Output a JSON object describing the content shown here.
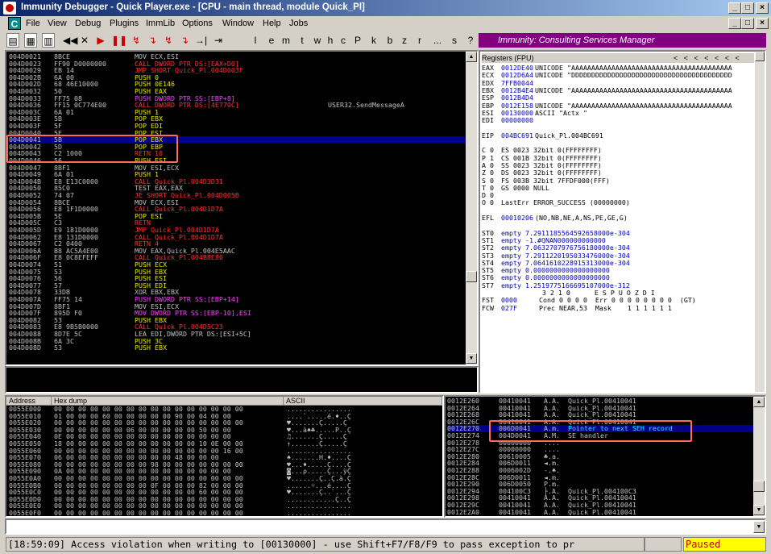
{
  "window": {
    "title": "Immunity Debugger - Quick Player.exe - [CPU - main thread, module Quick_Pl]"
  },
  "menu": [
    "File",
    "View",
    "Debug",
    "Plugins",
    "ImmLib",
    "Options",
    "Window",
    "Help",
    "Jobs"
  ],
  "toolbar": {
    "letters": [
      "l",
      "e",
      "m",
      "t",
      "w",
      "h",
      "c",
      "P",
      "k",
      "b",
      "z",
      "r",
      "...",
      "s",
      "?"
    ],
    "banner": "Immunity: Consulting Services Manager"
  },
  "disasm": {
    "rows": [
      {
        "a": "004D0021",
        "h": "8BCE",
        "i": "MOV ECX,ESI",
        "c": "",
        "k": "w"
      },
      {
        "a": "004D0023",
        "h": "FF90 D0000000",
        "i": "CALL DWORD PTR DS:[EAX+D0]",
        "c": "",
        "k": "r"
      },
      {
        "a": "004D0029",
        "h": "EB 14",
        "i": "JMP SHORT Quick_Pl.004D003F",
        "c": "",
        "k": "r"
      },
      {
        "a": "004D002B",
        "h": "6A 00",
        "i": "PUSH 0",
        "c": "",
        "k": "y"
      },
      {
        "a": "004D002D",
        "h": "68 46E10000",
        "i": "PUSH 0E146",
        "c": "",
        "k": "y"
      },
      {
        "a": "004D0032",
        "h": "50",
        "i": "PUSH EAX",
        "c": "",
        "k": "y"
      },
      {
        "a": "004D0033",
        "h": "FF75 08",
        "i": "PUSH DWORD PTR SS:[EBP+8]",
        "c": "",
        "k": "m"
      },
      {
        "a": "004D0036",
        "h": "FF15 0C774E00",
        "i": "CALL DWORD PTR DS:[4E770C]",
        "c": "USER32.SendMessageA",
        "k": "r"
      },
      {
        "a": "004D003C",
        "h": "6A 01",
        "i": "PUSH 1",
        "c": "",
        "k": "y"
      },
      {
        "a": "004D003E",
        "h": "5B",
        "i": "POP EBX",
        "c": "",
        "k": "y"
      },
      {
        "a": "004D003F",
        "h": "5F",
        "i": "POP EDI",
        "c": "",
        "k": "y"
      },
      {
        "a": "004D0040",
        "h": "5E",
        "i": "POP ESI",
        "c": "",
        "k": "y"
      },
      {
        "a": "004D0041",
        "h": "5B",
        "i": "POP EBX",
        "c": "",
        "k": "y"
      },
      {
        "a": "004D0042",
        "h": "5D",
        "i": "POP EBP",
        "c": "",
        "k": "y"
      },
      {
        "a": "004D0043",
        "h": "C2 1000",
        "i": "RETN 10",
        "c": "",
        "k": "r"
      },
      {
        "a": "004D0046",
        "h": "56",
        "i": "PUSH ESI",
        "c": "",
        "k": "y"
      },
      {
        "a": "004D0047",
        "h": "8BF1",
        "i": "MOV ESI,ECX",
        "c": "",
        "k": "w"
      },
      {
        "a": "004D0049",
        "h": "6A 01",
        "i": "PUSH 1",
        "c": "",
        "k": "y"
      },
      {
        "a": "004D004B",
        "h": "E8 E13C0000",
        "i": "CALL Quick_Pl.004D3D31",
        "c": "",
        "k": "r"
      },
      {
        "a": "004D0050",
        "h": "85C0",
        "i": "TEST EAX,EAX",
        "c": "",
        "k": "w"
      },
      {
        "a": "004D0052",
        "h": "74 07",
        "i": "JE SHORT Quick_Pl.004D005B",
        "c": "",
        "k": "r"
      },
      {
        "a": "004D0054",
        "h": "8BCE",
        "i": "MOV ECX,ESI",
        "c": "",
        "k": "w"
      },
      {
        "a": "004D0056",
        "h": "E8 1F1D0000",
        "i": "CALL Quick_Pl.004D1D7A",
        "c": "",
        "k": "r"
      },
      {
        "a": "004D005B",
        "h": "5E",
        "i": "POP ESI",
        "c": "",
        "k": "y"
      },
      {
        "a": "004D005C",
        "h": "C3",
        "i": "RETN",
        "c": "",
        "k": "r"
      },
      {
        "a": "004D005D",
        "h": "E9 181D0000",
        "i": "JMP Quick_Pl.004D1D7A",
        "c": "",
        "k": "r"
      },
      {
        "a": "004D0062",
        "h": "E8 131D0000",
        "i": "CALL Quick_Pl.004D1D7A",
        "c": "",
        "k": "r"
      },
      {
        "a": "004D0067",
        "h": "C2 0400",
        "i": "RETN 4",
        "c": "",
        "k": "r"
      },
      {
        "a": "004D006A",
        "h": "B8 AC5A4E00",
        "i": "MOV EAX,Quick_Pl.004E5AAC",
        "c": "",
        "k": "w"
      },
      {
        "a": "004D006F",
        "h": "E8 0C8EFEFF",
        "i": "CALL Quick_Pl.004B8E80",
        "c": "",
        "k": "r"
      },
      {
        "a": "004D0074",
        "h": "51",
        "i": "PUSH ECX",
        "c": "",
        "k": "y"
      },
      {
        "a": "004D0075",
        "h": "53",
        "i": "PUSH EBX",
        "c": "",
        "k": "y"
      },
      {
        "a": "004D0076",
        "h": "56",
        "i": "PUSH ESI",
        "c": "",
        "k": "y"
      },
      {
        "a": "004D0077",
        "h": "57",
        "i": "PUSH EDI",
        "c": "",
        "k": "y"
      },
      {
        "a": "004D0078",
        "h": "33DB",
        "i": "XOR EBX,EBX",
        "c": "",
        "k": "w"
      },
      {
        "a": "004D007A",
        "h": "FF75 14",
        "i": "PUSH DWORD PTR SS:[EBP+14]",
        "c": "",
        "k": "m"
      },
      {
        "a": "004D007D",
        "h": "8BF1",
        "i": "MOV ESI,ECX",
        "c": "",
        "k": "w"
      },
      {
        "a": "004D007F",
        "h": "895D F0",
        "i": "MOV DWORD PTR SS:[EBP-10],ESI",
        "c": "",
        "k": "m"
      },
      {
        "a": "004D0082",
        "h": "53",
        "i": "PUSH EBX",
        "c": "",
        "k": "y"
      },
      {
        "a": "004D0083",
        "h": "E8 9B5B0000",
        "i": "CALL Quick_Pl.004D5C23",
        "c": "",
        "k": "r"
      },
      {
        "a": "004D0088",
        "h": "8D7E 5C",
        "i": "LEA EDI,DWORD PTR DS:[ESI+5C]",
        "c": "",
        "k": "w"
      },
      {
        "a": "004D008B",
        "h": "6A 3C",
        "i": "PUSH 3C",
        "c": "",
        "k": "y"
      },
      {
        "a": "004D008D",
        "h": "53",
        "i": "PUSH EBX",
        "c": "",
        "k": "y"
      }
    ]
  },
  "registers": {
    "title": "Registers (FPU)",
    "nav": "<   <   <   <   <   <   <",
    "lines": [
      {
        "n": "EAX",
        "v": "0012DE40",
        "d": "UNICODE \"AAAAAAAAAAAAAAAAAAAAAAAAAAAAAAAAAAAAAAAA"
      },
      {
        "n": "ECX",
        "v": "0012D6A4",
        "d": "UNICODE \"DDDDDDDDDDDDDDDDDDDDDDDDDDDDDDDDDDDDDDDD"
      },
      {
        "n": "EDX",
        "v": "7FFB0044",
        "d": ""
      },
      {
        "n": "EBX",
        "v": "0012B4E4",
        "d": "UNICODE \"AAAAAAAAAAAAAAAAAAAAAAAAAAAAAAAAAAAAAAAA"
      },
      {
        "n": "ESP",
        "v": "0012B4D4",
        "d": ""
      },
      {
        "n": "EBP",
        "v": "0012E158",
        "d": "UNICODE \"AAAAAAAAAAAAAAAAAAAAAAAAAAAAAAAAAAAAAAAA"
      },
      {
        "n": "ESI",
        "v": "00130000",
        "d": "ASCII \"Actx \""
      },
      {
        "n": "EDI",
        "v": "00000000",
        "d": ""
      },
      {
        "n": "",
        "v": "",
        "d": ""
      },
      {
        "n": "EIP",
        "v": "004BC691",
        "d": "Quick_Pl.004BC691"
      },
      {
        "n": "",
        "v": "",
        "d": ""
      },
      {
        "n": "C 0",
        "v": "",
        "d": "ES 0023 32bit 0(FFFFFFFF)"
      },
      {
        "n": "P 1",
        "v": "",
        "d": "CS 001B 32bit 0(FFFFFFFF)"
      },
      {
        "n": "A 0",
        "v": "",
        "d": "SS 0023 32bit 0(FFFFFFFF)"
      },
      {
        "n": "Z 0",
        "v": "",
        "d": "DS 0023 32bit 0(FFFFFFFF)"
      },
      {
        "n": "S 0",
        "v": "",
        "d": "FS 003B 32bit 7FFDF000(FFF)"
      },
      {
        "n": "T 0",
        "v": "",
        "d": "GS 0000 NULL"
      },
      {
        "n": "D 0",
        "v": "",
        "d": ""
      },
      {
        "n": "O 0",
        "v": "",
        "d": "LastErr ERROR_SUCCESS (00000000)"
      },
      {
        "n": "",
        "v": "",
        "d": ""
      },
      {
        "n": "EFL",
        "v": "00010206",
        "d": "(NO,NB,NE,A,NS,PE,GE,G)"
      },
      {
        "n": "",
        "v": "",
        "d": ""
      },
      {
        "n": "ST0",
        "v": "",
        "d": "empty 7.2911185564592658000e-304"
      },
      {
        "n": "ST1",
        "v": "",
        "d": "empty -1.#QNAN000000000000"
      },
      {
        "n": "ST2",
        "v": "",
        "d": "empty 7.0632707976756180000e-304"
      },
      {
        "n": "ST3",
        "v": "",
        "d": "empty 7.2911220195033476000e-304"
      },
      {
        "n": "ST4",
        "v": "",
        "d": "empty 7.0641610228915313000e-304"
      },
      {
        "n": "ST5",
        "v": "",
        "d": "empty 0.0000000000000000000"
      },
      {
        "n": "ST6",
        "v": "",
        "d": "empty 0.0000000000000000000"
      },
      {
        "n": "ST7",
        "v": "",
        "d": "empty 1.2519775166695107000e-312"
      },
      {
        "n": "",
        "v": "",
        "d": "               3 2 1 0      E S P U O Z D I"
      },
      {
        "n": "FST",
        "v": "0000",
        "d": " Cond 0 0 0 0  Err 0 0 0 0 0 0 0 0  (GT)"
      },
      {
        "n": "FCW",
        "v": "027F",
        "d": " Prec NEAR,53  Mask    1 1 1 1 1 1"
      }
    ]
  },
  "dump": {
    "headers": [
      "Address",
      "Hex dump",
      "ASCII"
    ],
    "rows": [
      {
        "a": "0055E000",
        "h": "00 00 00 00 00 00 00 00 00 00 00 00 00 00 00 00",
        "s": "................"
      },
      {
        "a": "0055E010",
        "h": "01 00 00 00 60 00 00 00 00 00 90 00 04 00 00",
        "s": "....`.....é.♦..Ç"
      },
      {
        "a": "0055E020",
        "h": "00 00 00 00 00 00 00 00 00 00 00 00 00 00 00 00",
        "s": "♥.......Ç.....Ç"
      },
      {
        "a": "0055E030",
        "h": "00 00 00 00 00 00 06 00 00 00 00 00 50 00 00",
        "s": "♥...à♠♣.....P..Ç"
      },
      {
        "a": "0055E040",
        "h": "0E 00 00 00 00 00 00 00 00 00 00 00 00 00 00",
        "s": "♫.......Ç.....Ç"
      },
      {
        "a": "0055E050",
        "h": "18 00 00 00 00 00 00 00 00 00 00 00 10 0E 00 00",
        "s": "↑.......Ç.....Ç"
      },
      {
        "a": "0055E060",
        "h": "00 00 00 00 00 00 00 00 00 00 00 00 00 00 16 00",
        "s": "................"
      },
      {
        "a": "0055E070",
        "h": "06 00 00 00 00 00 00 00 00 00 48 00 00 00",
        "s": "♠.......H.♦....Ç"
      },
      {
        "a": "0055E080",
        "h": "00 00 00 00 00 00 00 00 98 00 00 00 00 00 00 00",
        "s": "♥...♦.....Ç....Ç"
      },
      {
        "a": "0055E090",
        "h": "0A 00 00 00 00 00 00 00 00 00 00 00 00 00 00",
        "s": "◙...ρ.....Ç...ÿÇ"
      },
      {
        "a": "0055E0A0",
        "h": "00 00 00 00 00 00 00 00 00 00 00 00 00 00 00 00",
        "s": "♥.......Ç..Ç.à.Ç"
      },
      {
        "a": "0055E0B0",
        "h": "00 00 00 00 00 00 00 00 0F 00 00 00 82 00 00 00",
        "s": "......☼...é....Ç"
      },
      {
        "a": "0055E0C0",
        "h": "00 00 00 00 00 00 00 00 00 00 00 00 60 00 00 00",
        "s": "♥.......Ç..`...Ç"
      },
      {
        "a": "0055E0D0",
        "h": "00 00 00 00 00 00 00 00 00 00 00 00 00 00 00 00",
        "s": "............Ç..Ç"
      },
      {
        "a": "0055E0E0",
        "h": "00 00 00 00 00 00 00 00 00 00 00 00 00 00 00 00",
        "s": "................"
      },
      {
        "a": "0055E0F0",
        "h": "00 00 00 00 00 00 00 00 00 00 00 00 00 00 00 00",
        "s": "................"
      }
    ]
  },
  "stack": {
    "rows": [
      {
        "a": "0012E260",
        "v": "00410041",
        "s": "A.A.",
        "c": "Quick_Pl.00410041",
        "k": "n"
      },
      {
        "a": "0012E264",
        "v": "00410041",
        "s": "A.A.",
        "c": "Quick_Pl.00410041",
        "k": "n"
      },
      {
        "a": "0012E268",
        "v": "00410041",
        "s": "A.A.",
        "c": "Quick_Pl.00410041",
        "k": "n"
      },
      {
        "a": "0012E26C",
        "v": "00410041",
        "s": "A.A.",
        "c": "Quick_Pl.00410041",
        "k": "n"
      },
      {
        "a": "0012E270",
        "v": "006D0041",
        "s": "A.m.",
        "c": "Pointer to next SEH record",
        "k": "h"
      },
      {
        "a": "0012E274",
        "v": "004D0041",
        "s": "A.M.",
        "c": "SE handler",
        "k": "n"
      },
      {
        "a": "0012E278",
        "v": "00000000",
        "s": "....",
        "c": "",
        "k": "n"
      },
      {
        "a": "0012E27C",
        "v": "00000000",
        "s": "....",
        "c": "",
        "k": "n"
      },
      {
        "a": "0012E280",
        "v": "00610005",
        "s": "♣.a.",
        "c": "",
        "k": "n"
      },
      {
        "a": "0012E284",
        "v": "006D0011",
        "s": "◄.m.",
        "c": "",
        "k": "n"
      },
      {
        "a": "0012E288",
        "v": "0006002D",
        "s": "-.♠.",
        "c": "",
        "k": "n"
      },
      {
        "a": "0012E28C",
        "v": "006D0011",
        "s": "◄.m.",
        "c": "",
        "k": "n"
      },
      {
        "a": "0012E290",
        "v": "006D0050",
        "s": "P.m.",
        "c": "",
        "k": "n"
      },
      {
        "a": "0012E294",
        "v": "004100C3",
        "s": "├.A.",
        "c": "Quick_Pl.004100C3",
        "k": "n"
      },
      {
        "a": "0012E298",
        "v": "00410041",
        "s": "A.A.",
        "c": "Quick_Pl.00410041",
        "k": "n"
      },
      {
        "a": "0012E29C",
        "v": "00410041",
        "s": "A.A.",
        "c": "Quick_Pl.00410041",
        "k": "n"
      },
      {
        "a": "0012E2A0",
        "v": "00410041",
        "s": "A.A.",
        "c": "Quick_Pl.00410041",
        "k": "n"
      }
    ]
  },
  "status": {
    "message": "[18:59:09] Access violation when writing to [00130000] - use Shift+F7/F8/F9 to pass exception to pr",
    "state": "Paused"
  }
}
